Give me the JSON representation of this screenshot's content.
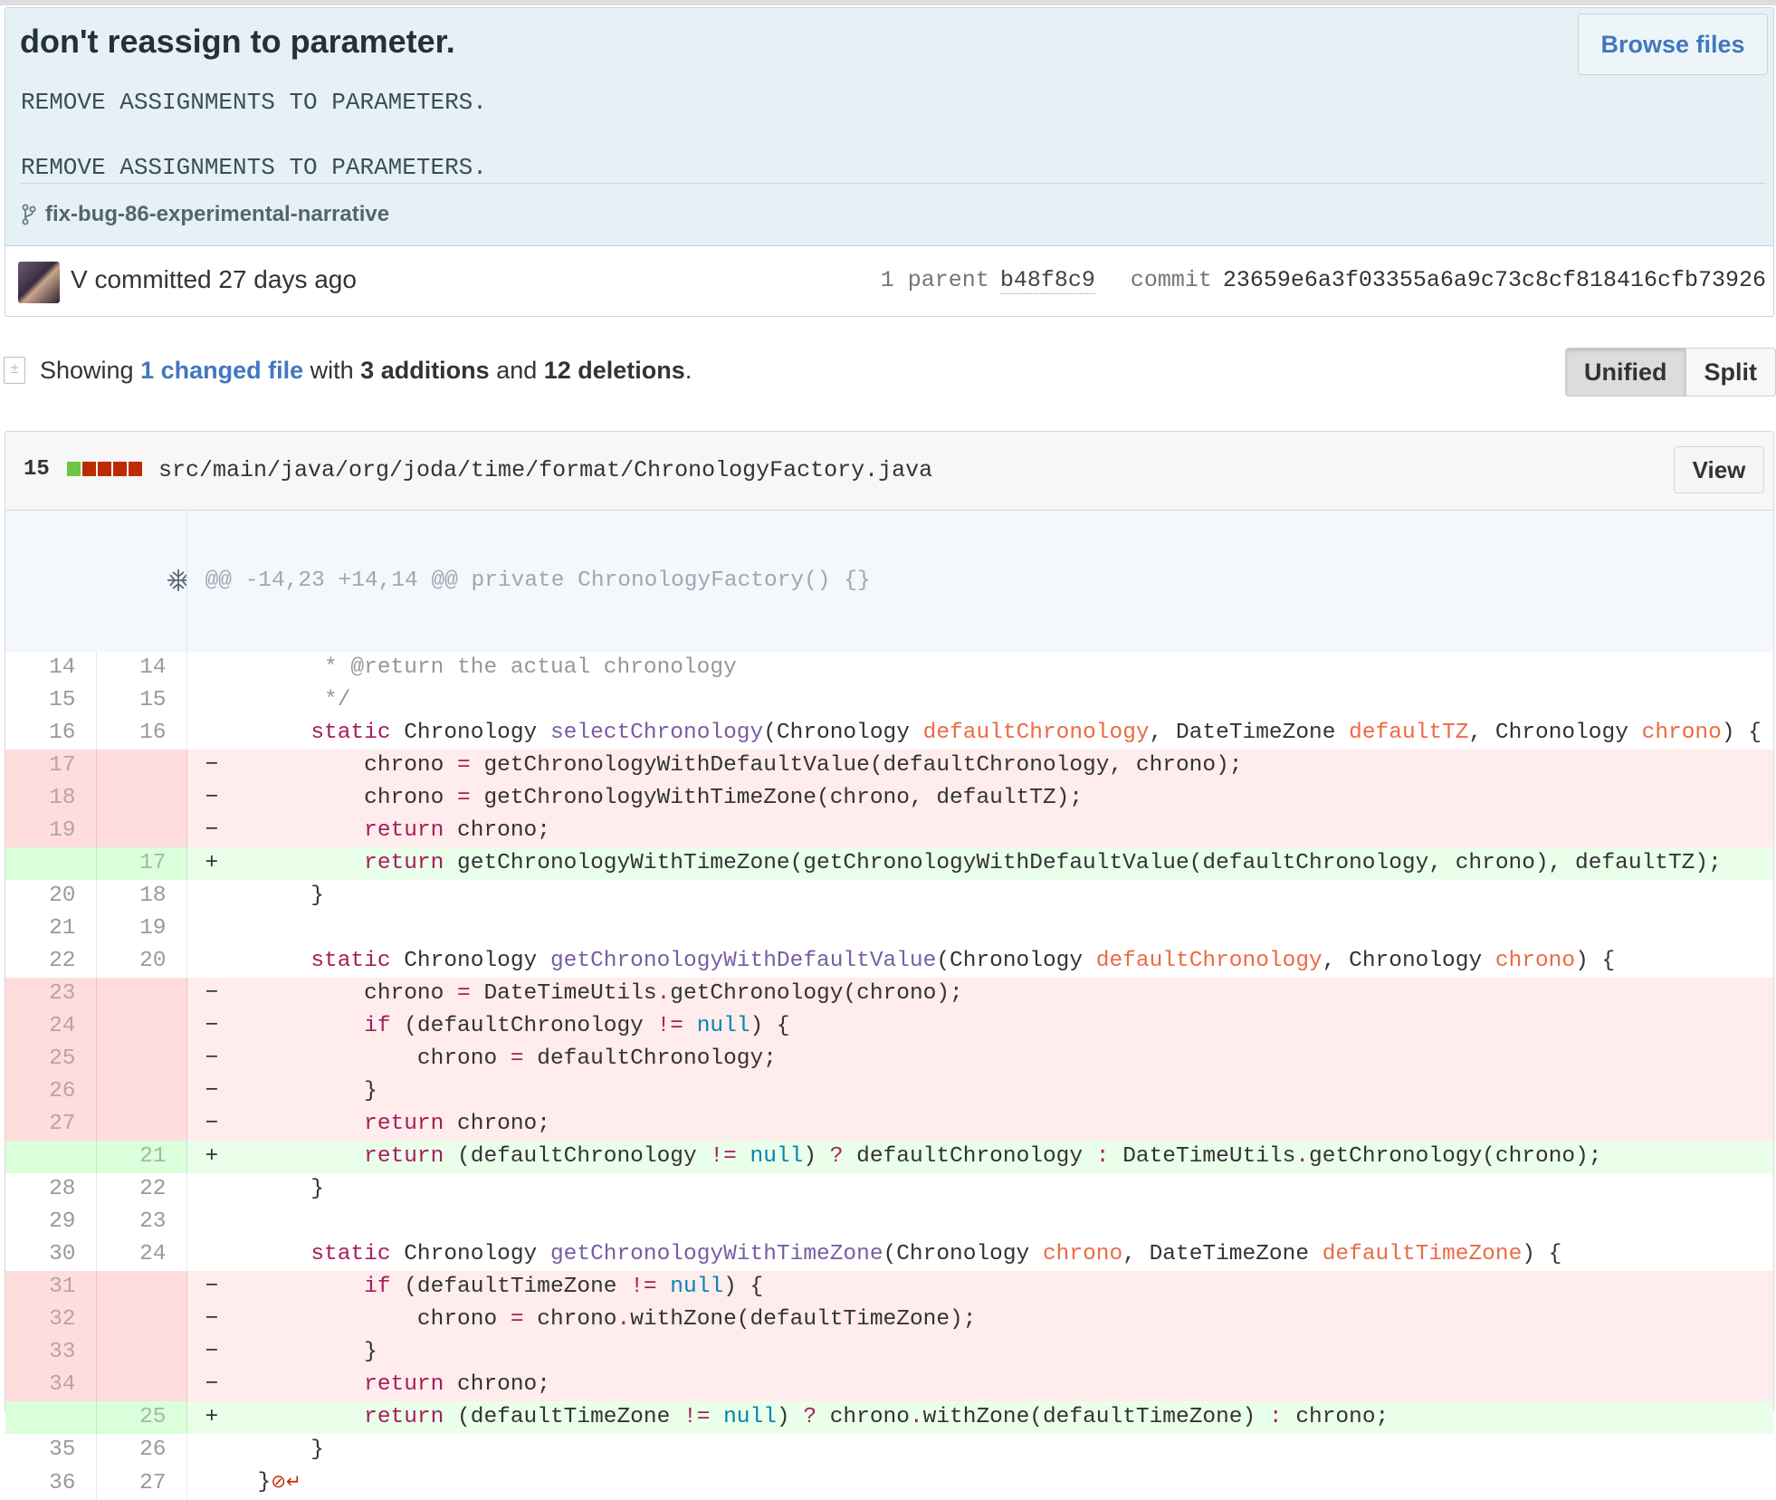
{
  "commit": {
    "title": "don't reassign to parameter.",
    "description": "REMOVE ASSIGNMENTS TO PARAMETERS.\nREMOVE ASSIGNMENTS TO PARAMETERS.",
    "browse_label": "Browse files",
    "branch": "fix-bug-86-experimental-narrative",
    "author_line": "V committed 27 days ago",
    "parent_label": "1 parent",
    "parent_sha": "b48f8c9",
    "commit_label": "commit",
    "commit_sha": "23659e6a3f03355a6a9c73c8cf818416cfb73926"
  },
  "toc": {
    "showing": "Showing ",
    "changed_link": "1 changed file",
    "with": " with ",
    "additions": "3 additions",
    "and": " and ",
    "deletions": "12 deletions",
    "period": ".",
    "unified_label": "Unified",
    "split_label": "Split"
  },
  "file": {
    "change_count": "15",
    "diffstat": [
      "add",
      "del",
      "del",
      "del",
      "del"
    ],
    "path": "src/main/java/org/joda/time/format/ChronologyFactory.java",
    "view_label": "View",
    "hunk_header": "@@ -14,23 +14,14 @@ private ChronologyFactory() {}"
  },
  "lines": [
    {
      "type": "ctx",
      "old": "14",
      "new": "14",
      "tokens": [
        [
          "",
          "     "
        ],
        [
          "cmt",
          "* @return the actual chronology"
        ]
      ]
    },
    {
      "type": "ctx",
      "old": "15",
      "new": "15",
      "tokens": [
        [
          "",
          "     "
        ],
        [
          "cmt",
          "*/"
        ]
      ]
    },
    {
      "type": "ctx",
      "old": "16",
      "new": "16",
      "tokens": [
        [
          "",
          "    "
        ],
        [
          "kw",
          "static"
        ],
        [
          "",
          " Chronology "
        ],
        [
          "ent",
          "selectChronology"
        ],
        [
          "",
          "(Chronology "
        ],
        [
          "var",
          "defaultChronology"
        ],
        [
          "",
          ", DateTimeZone "
        ],
        [
          "var",
          "defaultTZ"
        ],
        [
          "",
          ", Chronology "
        ],
        [
          "var",
          "chrono"
        ],
        [
          "",
          ") {"
        ]
      ]
    },
    {
      "type": "del",
      "old": "17",
      "new": "",
      "tokens": [
        [
          "",
          "        chrono "
        ],
        [
          "kw",
          "="
        ],
        [
          "",
          " getChronologyWithDefaultValue(defaultChronology, chrono);"
        ]
      ]
    },
    {
      "type": "del",
      "old": "18",
      "new": "",
      "tokens": [
        [
          "",
          "        chrono "
        ],
        [
          "kw",
          "="
        ],
        [
          "",
          " getChronologyWithTimeZone(chrono, defaultTZ);"
        ]
      ]
    },
    {
      "type": "del",
      "old": "19",
      "new": "",
      "tokens": [
        [
          "",
          "        "
        ],
        [
          "kw",
          "return"
        ],
        [
          "",
          " chrono;"
        ]
      ]
    },
    {
      "type": "add",
      "old": "",
      "new": "17",
      "tokens": [
        [
          "",
          "        "
        ],
        [
          "kw",
          "return"
        ],
        [
          "",
          " getChronologyWithTimeZone(getChronologyWithDefaultValue(defaultChronology, chrono), defaultTZ);"
        ]
      ]
    },
    {
      "type": "ctx",
      "old": "20",
      "new": "18",
      "tokens": [
        [
          "",
          "    }"
        ]
      ]
    },
    {
      "type": "ctx",
      "old": "21",
      "new": "19",
      "tokens": [
        [
          "",
          ""
        ]
      ]
    },
    {
      "type": "ctx",
      "old": "22",
      "new": "20",
      "tokens": [
        [
          "",
          "    "
        ],
        [
          "kw",
          "static"
        ],
        [
          "",
          " Chronology "
        ],
        [
          "ent",
          "getChronologyWithDefaultValue"
        ],
        [
          "",
          "(Chronology "
        ],
        [
          "var",
          "defaultChronology"
        ],
        [
          "",
          ", Chronology "
        ],
        [
          "var",
          "chrono"
        ],
        [
          "",
          ") {"
        ]
      ]
    },
    {
      "type": "del",
      "old": "23",
      "new": "",
      "tokens": [
        [
          "",
          "        chrono "
        ],
        [
          "kw",
          "="
        ],
        [
          "",
          " DateTimeUtils"
        ],
        [
          "kw",
          "."
        ],
        [
          "",
          "getChronology(chrono);"
        ]
      ]
    },
    {
      "type": "del",
      "old": "24",
      "new": "",
      "tokens": [
        [
          "",
          "        "
        ],
        [
          "kw",
          "if"
        ],
        [
          "",
          " (defaultChronology "
        ],
        [
          "kw",
          "!="
        ],
        [
          "",
          " "
        ],
        [
          "cst",
          "null"
        ],
        [
          "",
          ") {"
        ]
      ]
    },
    {
      "type": "del",
      "old": "25",
      "new": "",
      "tokens": [
        [
          "",
          "            chrono "
        ],
        [
          "kw",
          "="
        ],
        [
          "",
          " defaultChronology;"
        ]
      ]
    },
    {
      "type": "del",
      "old": "26",
      "new": "",
      "tokens": [
        [
          "",
          "        }"
        ]
      ]
    },
    {
      "type": "del",
      "old": "27",
      "new": "",
      "tokens": [
        [
          "",
          "        "
        ],
        [
          "kw",
          "return"
        ],
        [
          "",
          " chrono;"
        ]
      ]
    },
    {
      "type": "add",
      "old": "",
      "new": "21",
      "tokens": [
        [
          "",
          "        "
        ],
        [
          "kw",
          "return"
        ],
        [
          "",
          " (defaultChronology "
        ],
        [
          "kw",
          "!="
        ],
        [
          "",
          " "
        ],
        [
          "cst",
          "null"
        ],
        [
          "",
          ") "
        ],
        [
          "kw",
          "?"
        ],
        [
          "",
          " defaultChronology "
        ],
        [
          "kw",
          ":"
        ],
        [
          "",
          " DateTimeUtils"
        ],
        [
          "kw",
          "."
        ],
        [
          "",
          "getChronology(chrono);"
        ]
      ]
    },
    {
      "type": "ctx",
      "old": "28",
      "new": "22",
      "tokens": [
        [
          "",
          "    }"
        ]
      ]
    },
    {
      "type": "ctx",
      "old": "29",
      "new": "23",
      "tokens": [
        [
          "",
          ""
        ]
      ]
    },
    {
      "type": "ctx",
      "old": "30",
      "new": "24",
      "tokens": [
        [
          "",
          "    "
        ],
        [
          "kw",
          "static"
        ],
        [
          "",
          " Chronology "
        ],
        [
          "ent",
          "getChronologyWithTimeZone"
        ],
        [
          "",
          "(Chronology "
        ],
        [
          "var",
          "chrono"
        ],
        [
          "",
          ", DateTimeZone "
        ],
        [
          "var",
          "defaultTimeZone"
        ],
        [
          "",
          ") {"
        ]
      ]
    },
    {
      "type": "del",
      "old": "31",
      "new": "",
      "tokens": [
        [
          "",
          "        "
        ],
        [
          "kw",
          "if"
        ],
        [
          "",
          " (defaultTimeZone "
        ],
        [
          "kw",
          "!="
        ],
        [
          "",
          " "
        ],
        [
          "cst",
          "null"
        ],
        [
          "",
          ") {"
        ]
      ]
    },
    {
      "type": "del",
      "old": "32",
      "new": "",
      "tokens": [
        [
          "",
          "            chrono "
        ],
        [
          "kw",
          "="
        ],
        [
          "",
          " chrono"
        ],
        [
          "kw",
          "."
        ],
        [
          "",
          "withZone(defaultTimeZone);"
        ]
      ]
    },
    {
      "type": "del",
      "old": "33",
      "new": "",
      "tokens": [
        [
          "",
          "        }"
        ]
      ]
    },
    {
      "type": "del",
      "old": "34",
      "new": "",
      "tokens": [
        [
          "",
          "        "
        ],
        [
          "kw",
          "return"
        ],
        [
          "",
          " chrono;"
        ]
      ]
    },
    {
      "type": "add",
      "old": "",
      "new": "25",
      "tokens": [
        [
          "",
          "        "
        ],
        [
          "kw",
          "return"
        ],
        [
          "",
          " (defaultTimeZone "
        ],
        [
          "kw",
          "!="
        ],
        [
          "",
          " "
        ],
        [
          "cst",
          "null"
        ],
        [
          "",
          ") "
        ],
        [
          "kw",
          "?"
        ],
        [
          "",
          " chrono"
        ],
        [
          "kw",
          "."
        ],
        [
          "",
          "withZone(defaultTimeZone) "
        ],
        [
          "kw",
          ":"
        ],
        [
          "",
          " chrono;"
        ]
      ]
    },
    {
      "type": "ctx",
      "old": "35",
      "new": "26",
      "tokens": [
        [
          "",
          "    }"
        ]
      ]
    },
    {
      "type": "ctx",
      "old": "36",
      "new": "27",
      "tokens": [
        [
          "",
          "}"
        ],
        [
          "noeol",
          "⊘↵"
        ]
      ]
    }
  ]
}
